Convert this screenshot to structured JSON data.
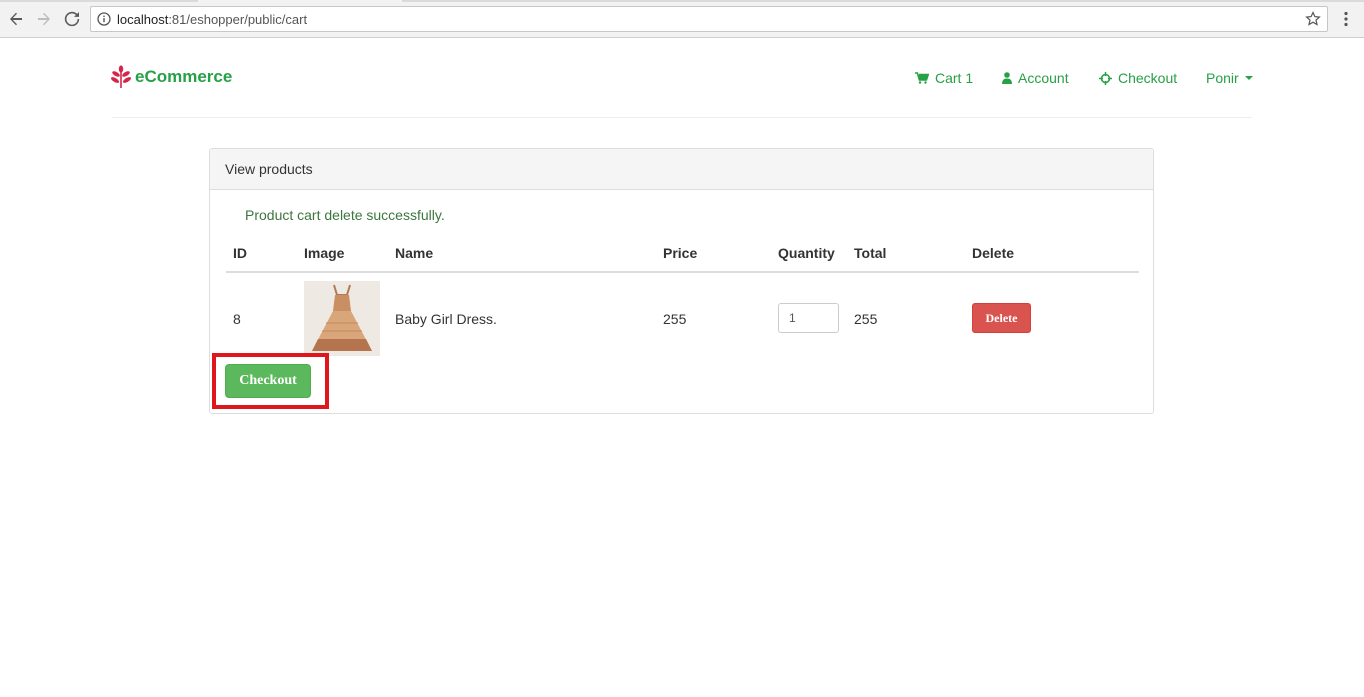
{
  "browser": {
    "url_host": "localhost",
    "url_rest": ":81/eshopper/public/cart"
  },
  "header": {
    "brand": "eCommerce",
    "nav": {
      "cart": "Cart 1",
      "account": "Account",
      "checkout": "Checkout",
      "user": "Ponir"
    }
  },
  "panel": {
    "title": "View products",
    "message": "Product cart delete successfully.",
    "columns": [
      "ID",
      "Image",
      "Name",
      "Price",
      "Quantity",
      "Total",
      "Delete"
    ],
    "rows": [
      {
        "id": "8",
        "name": "Baby Girl Dress.",
        "price": "255",
        "quantity": "1",
        "total": "255",
        "delete_label": "Delete"
      }
    ],
    "checkout_label": "Checkout"
  },
  "colors": {
    "brand": "#27a047",
    "success_btn": "#5cb85c",
    "danger_btn": "#d9534f",
    "highlight": "#e0161d",
    "alert_text": "#3c763d"
  }
}
